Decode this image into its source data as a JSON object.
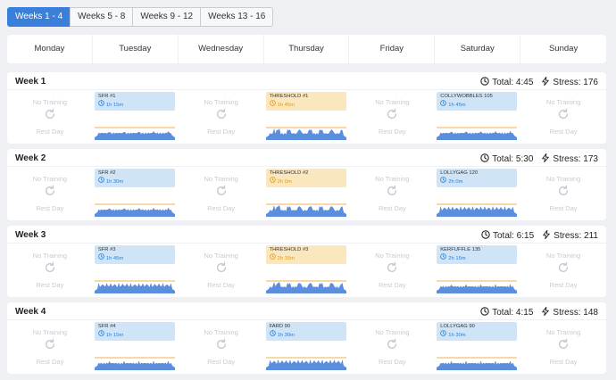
{
  "tabs": [
    {
      "label": "Weeks 1 - 4",
      "active": true
    },
    {
      "label": "Weeks 5 - 8",
      "active": false
    },
    {
      "label": "Weeks 9 - 12",
      "active": false
    },
    {
      "label": "Weeks 13 - 16",
      "active": false
    }
  ],
  "days": [
    "Monday",
    "Tuesday",
    "Wednesday",
    "Thursday",
    "Friday",
    "Saturday",
    "Sunday"
  ],
  "rest": {
    "no_training": "No Training",
    "rest_day": "Rest Day"
  },
  "colors": {
    "accent": "#3a80da",
    "endurance": "#cfe5f7",
    "threshold": "#fbe7bd",
    "profile": "#5b8fdd",
    "ftp_line": "#f2b14c"
  },
  "weeks": [
    {
      "title": "Week 1",
      "total": "Total: 4:45",
      "stress": "Stress: 176",
      "workouts": {
        "1": {
          "name": "SFR #1",
          "duration": "1h 15m",
          "type": "endurance"
        },
        "3": {
          "name": "THRESHOLD #1",
          "duration": "1h 45m",
          "type": "threshold"
        },
        "5": {
          "name": "COLLYWOBBLES 105",
          "duration": "1h 45m",
          "type": "endurance"
        }
      }
    },
    {
      "title": "Week 2",
      "total": "Total: 5:30",
      "stress": "Stress: 173",
      "workouts": {
        "1": {
          "name": "SFR #2",
          "duration": "1h 30m",
          "type": "endurance"
        },
        "3": {
          "name": "THRESHOLD #2",
          "duration": "2h 0m",
          "type": "threshold"
        },
        "5": {
          "name": "LOLLYGAG 120",
          "duration": "2h 0m",
          "type": "endurance"
        }
      }
    },
    {
      "title": "Week 3",
      "total": "Total: 6:15",
      "stress": "Stress: 211",
      "workouts": {
        "1": {
          "name": "SFR #3",
          "duration": "1h 45m",
          "type": "endurance"
        },
        "3": {
          "name": "THRESHOLD #3",
          "duration": "2h 15m",
          "type": "threshold"
        },
        "5": {
          "name": "KERFUFFLE 135",
          "duration": "2h 15m",
          "type": "endurance"
        }
      }
    },
    {
      "title": "Week 4",
      "total": "Total: 4:15",
      "stress": "Stress: 148",
      "workouts": {
        "1": {
          "name": "SFR #4",
          "duration": "1h 15m",
          "type": "endurance"
        },
        "3": {
          "name": "FARD 90",
          "duration": "1h 30m",
          "type": "endurance"
        },
        "5": {
          "name": "LOLLYGAG 90",
          "duration": "1h 30m",
          "type": "endurance"
        }
      }
    }
  ]
}
